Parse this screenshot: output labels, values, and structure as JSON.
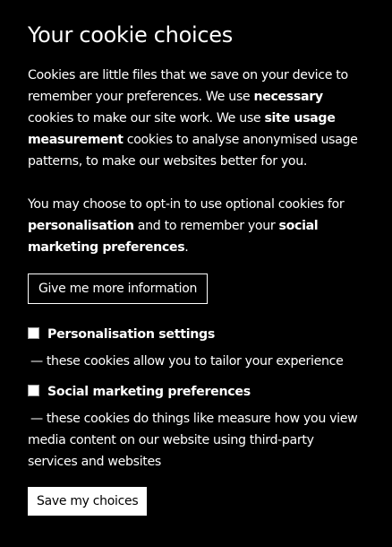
{
  "dialog": {
    "title": "Your cookie choices",
    "intro": {
      "p1_a": "Cookies are little files that we save on your device to remember your preferences. We use ",
      "p1_b": "necessary",
      "p1_c": " cookies to make our site work. We use ",
      "p1_d": "site usage measurement",
      "p1_e": " cookies to analyse anonymised usage patterns, to make our websites better for you.",
      "p2_a": "You may choose to opt-in to use optional cookies for ",
      "p2_b": "personalisation",
      "p2_c": " and to remember your ",
      "p2_d": "social marketing preferences",
      "p2_e": "."
    },
    "more_info_label": "Give me more information",
    "options": [
      {
        "label": "Personalisation settings",
        "dash": "—",
        "description": "these cookies allow you to tailor your experience",
        "checked": false
      },
      {
        "label": "Social marketing preferences",
        "dash": "—",
        "description": "these cookies do things like measure how you view media content on our website using third-party services and websites",
        "checked": false
      }
    ],
    "save_label": "Save my choices"
  },
  "colors": {
    "background": "#000000",
    "text": "#ffffff",
    "save_button_bg": "#ffffff",
    "save_button_text": "#000000"
  }
}
